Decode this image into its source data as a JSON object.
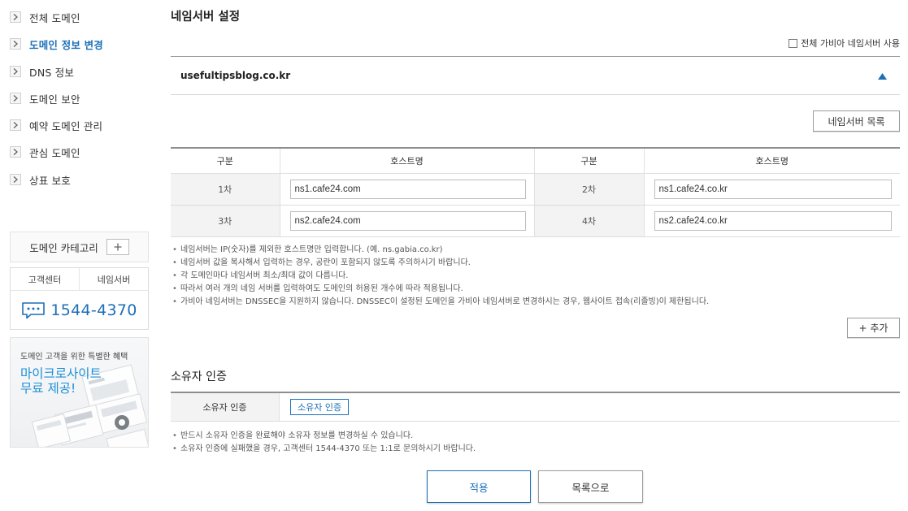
{
  "sidebar": {
    "items": [
      {
        "label": "전체 도메인"
      },
      {
        "label": "도메인 정보 변경"
      },
      {
        "label": "DNS 정보"
      },
      {
        "label": "도메인 보안"
      },
      {
        "label": "예약 도메인 관리"
      },
      {
        "label": "관심 도메인"
      },
      {
        "label": "상표 보호"
      }
    ],
    "category_label": "도메인 카테고리",
    "support": {
      "tab1": "고객센터",
      "tab2": "네임서버",
      "phone": "1544-4370"
    },
    "promo": {
      "subtitle": "도메인 고객을 위한 특별한 혜택",
      "title_line1": "마이크로사이트",
      "title_line2": "무료 제공!"
    }
  },
  "main": {
    "title": "네임서버 설정",
    "all_ns_label": "전체 가비아 네임서버 사용",
    "domain": "usefultipsblog.co.kr",
    "ns_list_button": "네임서버 목록",
    "table": {
      "headers": [
        "구분",
        "호스트명",
        "구분",
        "호스트명"
      ],
      "rows": [
        {
          "label1": "1차",
          "host1": "ns1.cafe24.com",
          "label2": "2차",
          "host2": "ns1.cafe24.co.kr"
        },
        {
          "label1": "3차",
          "host1": "ns2.cafe24.com",
          "label2": "4차",
          "host2": "ns2.cafe24.co.kr"
        }
      ]
    },
    "notes": [
      "네임서버는 IP(숫자)를 제외한 호스트명만 입력합니다. (예. ns.gabia.co.kr)",
      "네임서버 값을 복사해서 입력하는 경우, 공란이 포함되지 않도록 주의하시기 바랍니다.",
      "각 도메인마다 네임서버 최소/최대 값이 다릅니다.",
      "따라서 여러 개의 네임 서버를 입력하여도 도메인의 허용된 개수에 따라 적용됩니다.",
      "가비아 네임서버는 DNSSEC을 지원하지 않습니다. DNSSEC이 설정된 도메인을 가비아 네임서버로 변경하시는 경우, 웹사이트 접속(리졸빙)이 제한됩니다."
    ],
    "add_button": "+ 추가",
    "owner": {
      "title": "소유자 인증",
      "label": "소유자 인증",
      "button": "소유자 인증",
      "notes": [
        "반드시 소유자 인증을 완료해야 소유자 정보를 변경하실 수 있습니다.",
        "소유자 인증에 실패했을 경우, 고객센터 1544-4370 또는 1:1로 문의하시기 바랍니다."
      ]
    },
    "apply_button": "적용",
    "list_button": "목록으로"
  },
  "colors": {
    "accent": "#1d6fb8",
    "promo_title": "#1d8fd8",
    "table_label_bg": "#f3f3f3"
  },
  "icons": {
    "nav_arrow": "chevron-right-icon",
    "category_add": "plus-icon",
    "support_chat": "chat-bubble-icon",
    "collapse": "triangle-up-icon"
  }
}
